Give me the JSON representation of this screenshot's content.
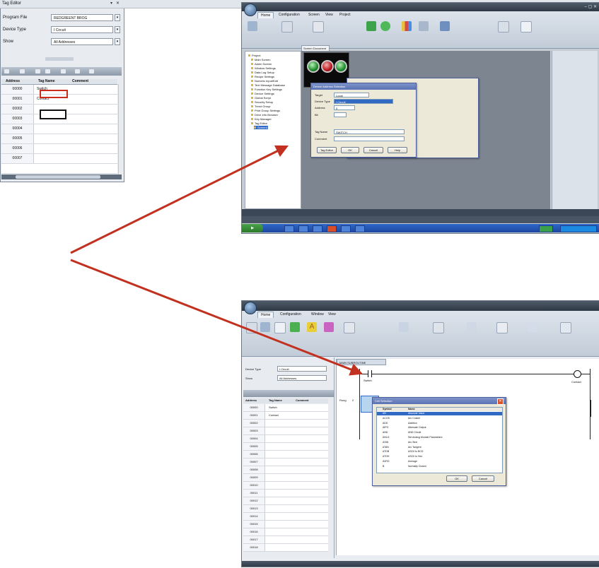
{
  "tag_editor": {
    "title": "Tag Editor",
    "rows": [
      {
        "label": "Program File",
        "value": "REDGREENT BROG"
      },
      {
        "label": "Device Type",
        "value": "I Circuit"
      },
      {
        "label": "Show",
        "value": "All Addresses"
      }
    ],
    "columns": [
      "Address",
      "Tag Name",
      "Comment"
    ],
    "grid": [
      {
        "address": "00000",
        "name": "Switch"
      },
      {
        "address": "00001",
        "name": "Contact"
      },
      {
        "address": "00002",
        "name": ""
      },
      {
        "address": "00003",
        "name": ""
      },
      {
        "address": "00004",
        "name": ""
      },
      {
        "address": "00005",
        "name": ""
      },
      {
        "address": "00006",
        "name": ""
      },
      {
        "address": "00007",
        "name": ""
      }
    ]
  },
  "top_shot": {
    "app_tabs": [
      "Home",
      "Configuration",
      "Screen",
      "View",
      "Project"
    ],
    "screen_tab": "Screen Document",
    "tree_items": [
      "Project",
      "Main Screen",
      "Alarm Screen",
      "Window Settings",
      "Data Log Setup",
      "Recipe Settings",
      "Numeric Input/Edit",
      "Text Message Database",
      "Function Key Settings",
      "Device Settings",
      "Global Script",
      "Security Setup",
      "Trend Group",
      "Print Group Settings",
      "Drive Info Browser",
      "Key Manager",
      "Tag Editor",
      "Screen1"
    ],
    "dialog": {
      "title": "Device Address Selection",
      "fields": [
        {
          "label": "Target",
          "value": "Local"
        },
        {
          "label": "Device Type",
          "value": "I Circuit"
        },
        {
          "label": "Address",
          "value": "0"
        },
        {
          "label": "Bit",
          "value": ""
        },
        {
          "label": "Tag Name",
          "value": "SWITCH"
        },
        {
          "label": "Comment",
          "value": ""
        }
      ],
      "buttons": [
        "Tag Editor",
        "OK",
        "Cancel",
        "Help"
      ]
    }
  },
  "bottom_shot": {
    "app_tabs": [
      "Home",
      "Configuration",
      "Window",
      "View"
    ],
    "ladder_tab": "MAIN SUBROUTINE",
    "rung_labels": [
      "Switch",
      "Contact"
    ],
    "rung_number": "2",
    "tag_editor_rows": [
      {
        "label": "Device Type",
        "value": "I Circuit"
      },
      {
        "label": "Show",
        "value": "All Addresses"
      }
    ],
    "tag_columns": [
      "Address",
      "Tag Name",
      "Comment"
    ],
    "tag_grid": [
      {
        "address": "00000",
        "name": "Switch"
      },
      {
        "address": "00001",
        "name": "Contact"
      },
      {
        "address": "00002",
        "name": ""
      },
      {
        "address": "00003",
        "name": ""
      },
      {
        "address": "00004",
        "name": ""
      },
      {
        "address": "00005",
        "name": ""
      },
      {
        "address": "00006",
        "name": ""
      },
      {
        "address": "00007",
        "name": ""
      },
      {
        "address": "00008",
        "name": ""
      },
      {
        "address": "00009",
        "name": ""
      },
      {
        "address": "00010",
        "name": ""
      },
      {
        "address": "00011",
        "name": ""
      },
      {
        "address": "00012",
        "name": ""
      },
      {
        "address": "00013",
        "name": ""
      },
      {
        "address": "00014",
        "name": ""
      },
      {
        "address": "00015",
        "name": ""
      },
      {
        "address": "00016",
        "name": ""
      },
      {
        "address": "00017",
        "name": ""
      },
      {
        "address": "00018",
        "name": ""
      }
    ],
    "dialog": {
      "title": "Cell Selection",
      "columns": [
        "Symbol",
        "Name"
      ],
      "rows": [
        {
          "symbol": "AB",
          "name": "Absolute Value"
        },
        {
          "symbol": "ACOS",
          "name": "Arc Cosine"
        },
        {
          "symbol": "ADD",
          "name": "Addition"
        },
        {
          "symbol": "AIPO",
          "name": "Alternate Output"
        },
        {
          "symbol": "AND",
          "name": "AND Circuit"
        },
        {
          "symbol": "ANLG",
          "name": "Set Analog Module Parameters"
        },
        {
          "symbol": "ASIN",
          "name": "Arc Sine"
        },
        {
          "symbol": "ATAN",
          "name": "Arc Tangent"
        },
        {
          "symbol": "ATOB",
          "name": "ASCII to BCD"
        },
        {
          "symbol": "ATOH",
          "name": "ASCII to Hex"
        },
        {
          "symbol": "AVRG",
          "name": "Average"
        },
        {
          "symbol": "B",
          "name": "Normally Closed"
        }
      ],
      "buttons": [
        "OK",
        "Cancel"
      ]
    }
  },
  "colors": {
    "arrow": "#c2301f",
    "highlight": "#cc2e1e"
  }
}
